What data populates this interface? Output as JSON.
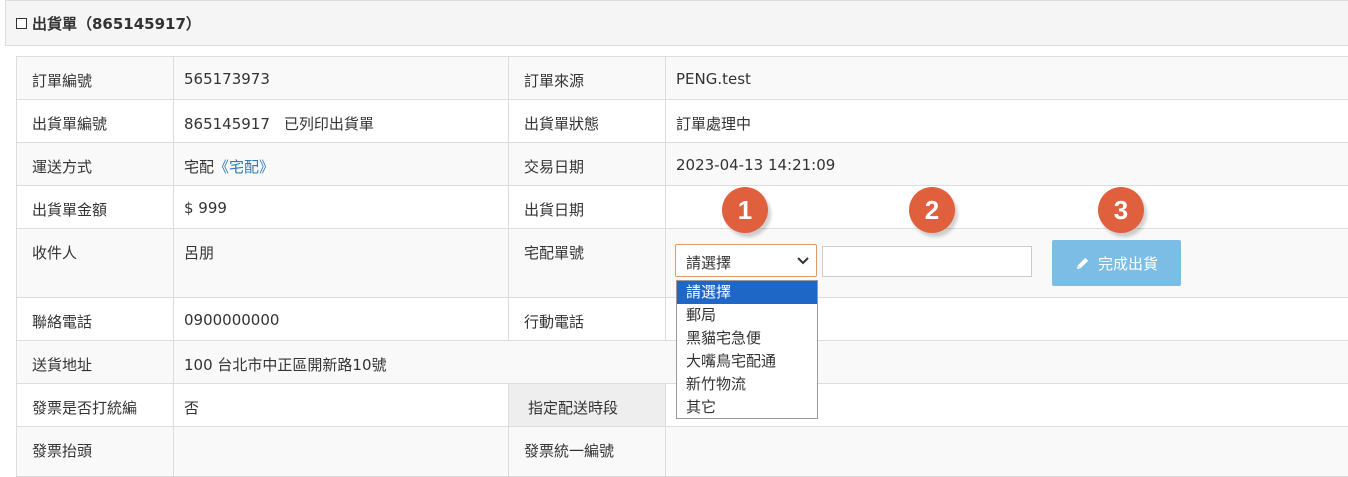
{
  "panel": {
    "title": "出貨單（865145917）"
  },
  "rows": [
    {
      "l1": "訂單編號",
      "v1": "565173973",
      "l2": "訂單來源",
      "v2": "PENG.test"
    },
    {
      "l1": "出貨單編號",
      "v1": "865145917",
      "v1b": "已列印出貨單",
      "l2": "出貨單狀態",
      "v2": "訂單處理中"
    },
    {
      "l1": "運送方式",
      "v1": "宅配",
      "v1link": "《宅配》",
      "l2": "交易日期",
      "v2": "2023-04-13 14:21:09"
    },
    {
      "l1": "出貨單金額",
      "v1": "$ 999",
      "l2": "出貨日期",
      "v2": ""
    },
    {
      "l1": "收件人",
      "v1": "呂朋",
      "l2": "宅配單號"
    },
    {
      "l1": "聯絡電話",
      "v1": "0900000000",
      "l2": "行動電話",
      "v2": ""
    },
    {
      "l1": "送貨地址",
      "v1": "100 台北市中正區開新路10號"
    },
    {
      "l1": "發票是否打統編",
      "v1": "否",
      "l2": "指定配送時段",
      "v2": ""
    },
    {
      "l1": "發票抬頭",
      "v1": "",
      "l2": "發票統一編號",
      "v2": ""
    }
  ],
  "carrier": {
    "selected": "請選擇",
    "options": [
      "請選擇",
      "郵局",
      "黑貓宅急便",
      "大嘴鳥宅配通",
      "新竹物流",
      "其它"
    ],
    "tracking_value": ""
  },
  "complete_button": {
    "label": "完成出貨",
    "icon": "pencil-icon",
    "color": "#7bbde5"
  },
  "step_badges": [
    "1",
    "2",
    "3"
  ],
  "colors": {
    "badge": "#e0603d",
    "link": "#337ab7",
    "selected_option": "#1e67c6"
  }
}
